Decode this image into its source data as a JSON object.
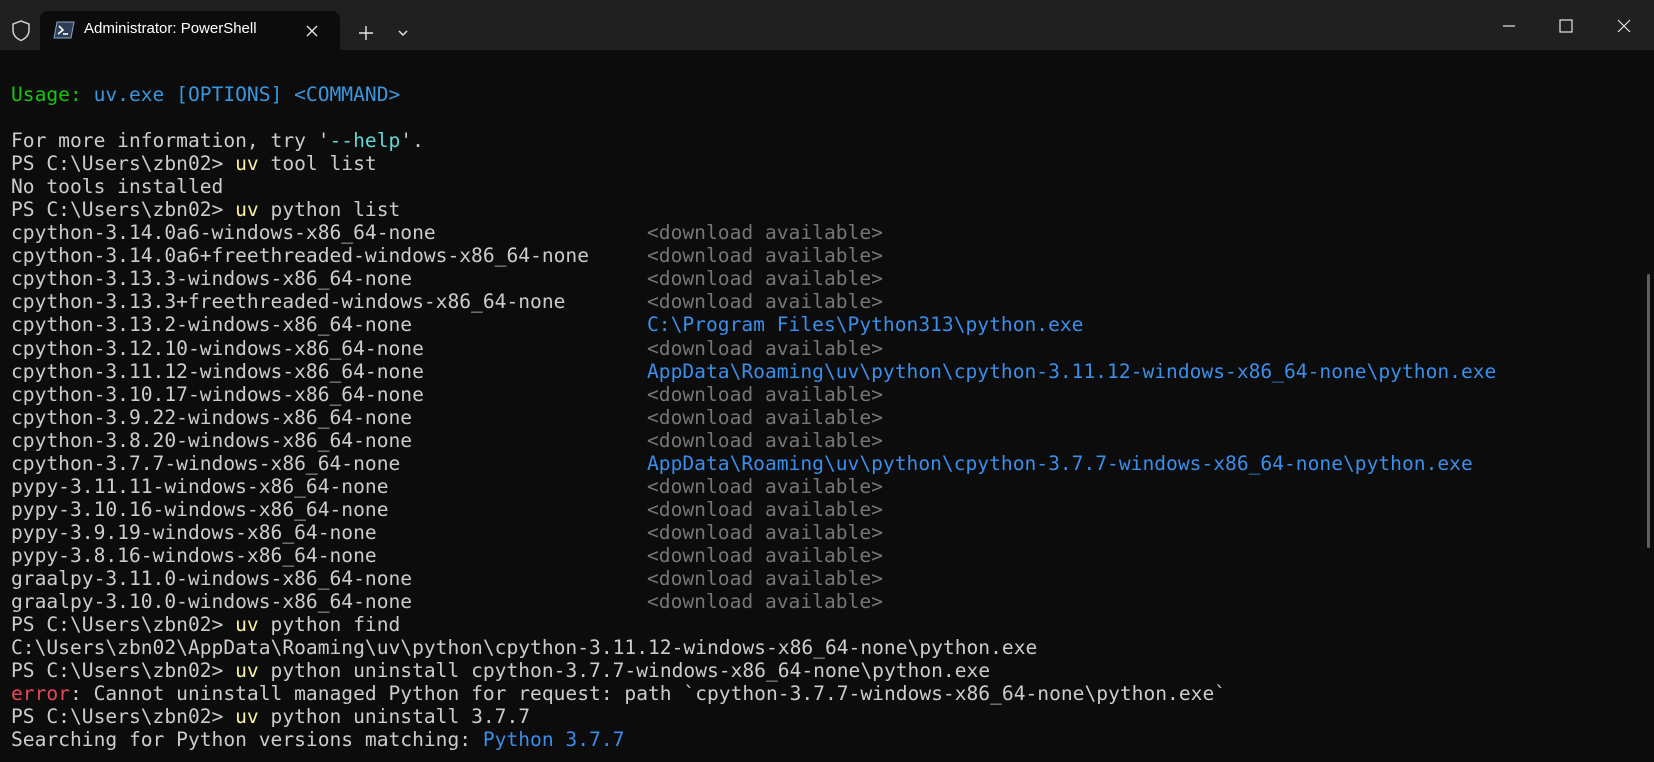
{
  "window": {
    "tab_title": "Administrator: PowerShell",
    "icons": {
      "shield": "shield-icon",
      "tab": "powershell-icon",
      "close_tab": "close-icon",
      "new_tab": "plus-icon",
      "dropdown": "chevron-down-icon",
      "minimize": "minimize-icon",
      "maximize": "maximize-icon",
      "close_window": "close-icon"
    }
  },
  "colors": {
    "background": "#0c0c0c",
    "titlebar": "#202020",
    "text": "#cccccc",
    "green": "#16c60c",
    "blue": "#3b8eea",
    "cyan": "#61d6d6",
    "yellow": "#f9f1a5",
    "gray": "#767676",
    "red": "#e74856"
  },
  "terminal": {
    "usage": {
      "label": "Usage:",
      "exe": "uv.exe",
      "options": "[OPTIONS]",
      "command": "<COMMAND>"
    },
    "more_info": {
      "before": "For more information, try '",
      "flag": "--help",
      "after": "'."
    },
    "prompt": "PS C:\\Users\\zbn02> ",
    "cmd_tool_list": {
      "uv": "uv",
      "args": " tool list"
    },
    "no_tools": "No tools installed",
    "cmd_python_list": {
      "uv": "uv",
      "args": " python list"
    },
    "python_list": [
      {
        "name": "cpython-3.14.0a6-windows-x86_64-none",
        "location": "<download available>",
        "installed": false
      },
      {
        "name": "cpython-3.14.0a6+freethreaded-windows-x86_64-none",
        "location": "<download available>",
        "installed": false
      },
      {
        "name": "cpython-3.13.3-windows-x86_64-none",
        "location": "<download available>",
        "installed": false
      },
      {
        "name": "cpython-3.13.3+freethreaded-windows-x86_64-none",
        "location": "<download available>",
        "installed": false
      },
      {
        "name": "cpython-3.13.2-windows-x86_64-none",
        "location": "C:\\Program Files\\Python313\\python.exe",
        "installed": true
      },
      {
        "name": "cpython-3.12.10-windows-x86_64-none",
        "location": "<download available>",
        "installed": false
      },
      {
        "name": "cpython-3.11.12-windows-x86_64-none",
        "location": "AppData\\Roaming\\uv\\python\\cpython-3.11.12-windows-x86_64-none\\python.exe",
        "installed": true
      },
      {
        "name": "cpython-3.10.17-windows-x86_64-none",
        "location": "<download available>",
        "installed": false
      },
      {
        "name": "cpython-3.9.22-windows-x86_64-none",
        "location": "<download available>",
        "installed": false
      },
      {
        "name": "cpython-3.8.20-windows-x86_64-none",
        "location": "<download available>",
        "installed": false
      },
      {
        "name": "cpython-3.7.7-windows-x86_64-none",
        "location": "AppData\\Roaming\\uv\\python\\cpython-3.7.7-windows-x86_64-none\\python.exe",
        "installed": true
      },
      {
        "name": "pypy-3.11.11-windows-x86_64-none",
        "location": "<download available>",
        "installed": false
      },
      {
        "name": "pypy-3.10.16-windows-x86_64-none",
        "location": "<download available>",
        "installed": false
      },
      {
        "name": "pypy-3.9.19-windows-x86_64-none",
        "location": "<download available>",
        "installed": false
      },
      {
        "name": "pypy-3.8.16-windows-x86_64-none",
        "location": "<download available>",
        "installed": false
      },
      {
        "name": "graalpy-3.11.0-windows-x86_64-none",
        "location": "<download available>",
        "installed": false
      },
      {
        "name": "graalpy-3.10.0-windows-x86_64-none",
        "location": "<download available>",
        "installed": false
      }
    ],
    "cmd_python_find": {
      "uv": "uv",
      "args": " python find"
    },
    "find_result": "C:\\Users\\zbn02\\AppData\\Roaming\\uv\\python\\cpython-3.11.12-windows-x86_64-none\\python.exe",
    "cmd_uninstall_path": {
      "uv": "uv",
      "args": " python uninstall cpython-3.7.7-windows-x86_64-none\\python.exe"
    },
    "error": {
      "label": "error",
      "message": ": Cannot uninstall managed Python for request: path `cpython-3.7.7-windows-x86_64-none\\python.exe`"
    },
    "cmd_uninstall_version": {
      "uv": "uv",
      "args": " python uninstall 3.7.7"
    },
    "searching": {
      "text": "Searching for Python versions matching: ",
      "match": "Python 3.7.7"
    }
  }
}
